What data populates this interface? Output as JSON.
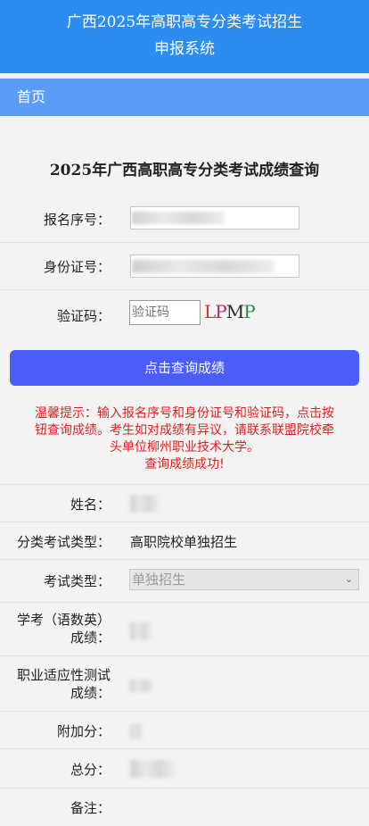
{
  "header": {
    "line1": "广西2025年高职高专分类考试招生",
    "line2": "申报系统"
  },
  "nav": {
    "home": "首页"
  },
  "page_title": "2025年广西高职高专分类考试成绩查询",
  "form": {
    "reg_no_label": "报名序号：",
    "id_label": "身份证号：",
    "captcha_label": "验证码：",
    "captcha_placeholder": "验证码",
    "captcha_chars": [
      "L",
      "P",
      "M",
      "P"
    ],
    "submit_label": "点击查询成绩"
  },
  "tip": {
    "line1": "温馨提示：输入报名序号和身份证号和验证码，点击按",
    "line2": "钮查询成绩。考生如对成绩有异议，请联系联盟院校牵",
    "line3": "头单位柳州职业技术大学。",
    "line4": "查询成绩成功!"
  },
  "result": {
    "name_label": "姓名：",
    "category_label": "分类考试类型：",
    "category_value": "高职院校单独招生",
    "exam_type_label": "考试类型：",
    "exam_type_value": "单独招生",
    "academic_label_1": "学考（语数英）",
    "academic_label_2": "成绩：",
    "vocational_label_1": "职业适应性测试",
    "vocational_label_2": "成绩：",
    "bonus_label": "附加分：",
    "total_label": "总分：",
    "remarks_label": "备注："
  },
  "colors": {
    "header": "#2d8cf0",
    "nav": "#5b9cf6",
    "button": "#4a5ef7",
    "tip": "#e02020"
  }
}
